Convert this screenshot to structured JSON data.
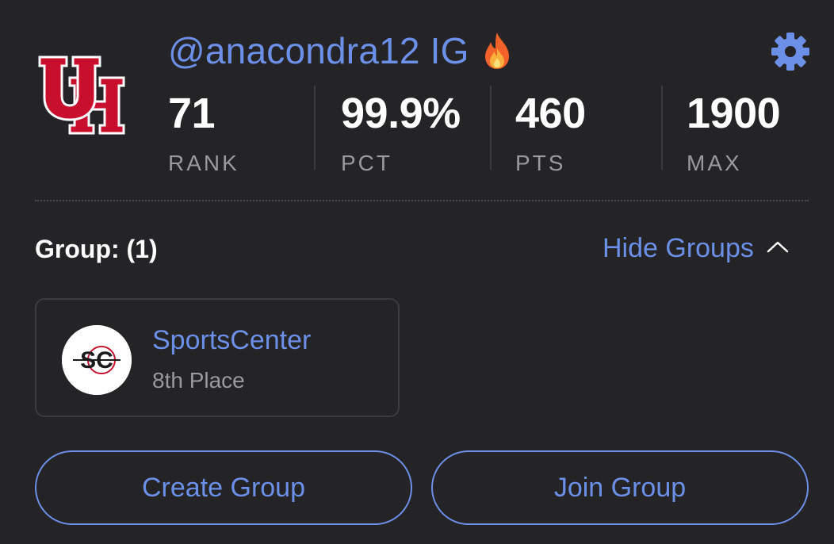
{
  "profile": {
    "username": "@anacondra12 IG",
    "logo_icon": "uh-logo-icon",
    "status_icon": "fire-icon",
    "settings_icon": "gear-icon",
    "accent_color": "#6c8fe8"
  },
  "stats": [
    {
      "value": "71",
      "label": "RANK"
    },
    {
      "value": "99.9%",
      "label": "PCT"
    },
    {
      "value": "460",
      "label": "PTS"
    },
    {
      "value": "1900",
      "label": "MAX"
    }
  ],
  "groups": {
    "title": "Group: (1)",
    "toggle_label": "Hide Groups",
    "toggle_icon": "chevron-up-icon",
    "items": [
      {
        "name": "SportsCenter",
        "place": "8th Place",
        "avatar_icon": "sc-logo-icon"
      }
    ]
  },
  "actions": {
    "create_label": "Create Group",
    "join_label": "Join Group"
  }
}
